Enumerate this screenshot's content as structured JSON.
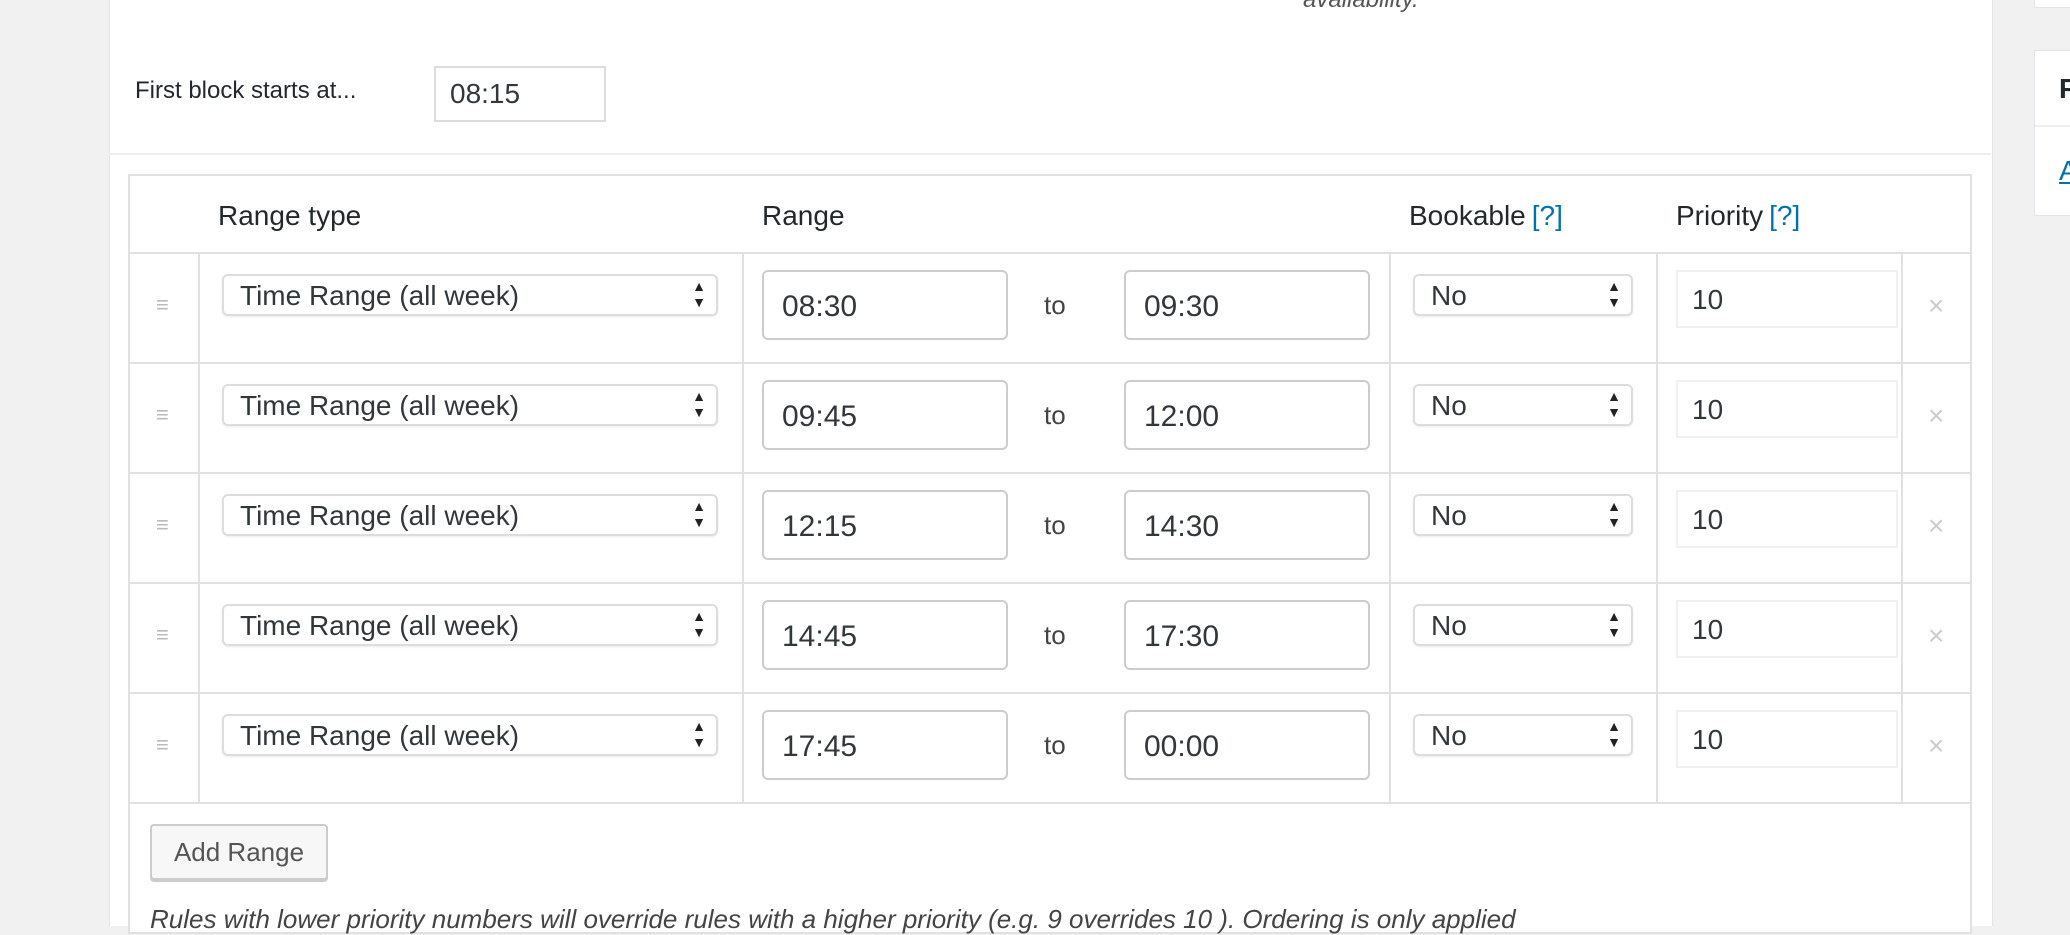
{
  "top_note": "availability.",
  "first_block": {
    "label": "First block starts at...",
    "value": "08:15"
  },
  "table": {
    "headers": {
      "range_type": "Range type",
      "range": "Range",
      "bookable": "Bookable",
      "priority": "Priority",
      "help": "[?]"
    },
    "rows": [
      {
        "type": "Time Range (all week)",
        "from": "08:30",
        "to_label": "to",
        "to": "09:30",
        "bookable": "No",
        "priority": "10"
      },
      {
        "type": "Time Range (all week)",
        "from": "09:45",
        "to_label": "to",
        "to": "12:00",
        "bookable": "No",
        "priority": "10"
      },
      {
        "type": "Time Range (all week)",
        "from": "12:15",
        "to_label": "to",
        "to": "14:30",
        "bookable": "No",
        "priority": "10"
      },
      {
        "type": "Time Range (all week)",
        "from": "14:45",
        "to_label": "to",
        "to": "17:30",
        "bookable": "No",
        "priority": "10"
      },
      {
        "type": "Time Range (all week)",
        "from": "17:45",
        "to_label": "to",
        "to": "00:00",
        "bookable": "No",
        "priority": "10"
      }
    ],
    "add_label": "Add Range",
    "note": "Rules with lower priority numbers will override rules with a higher priority (e.g. 9 overrides 10 ). Ordering is only applied"
  },
  "side_panel": {
    "title_letter": "P",
    "link_letter": "A"
  }
}
